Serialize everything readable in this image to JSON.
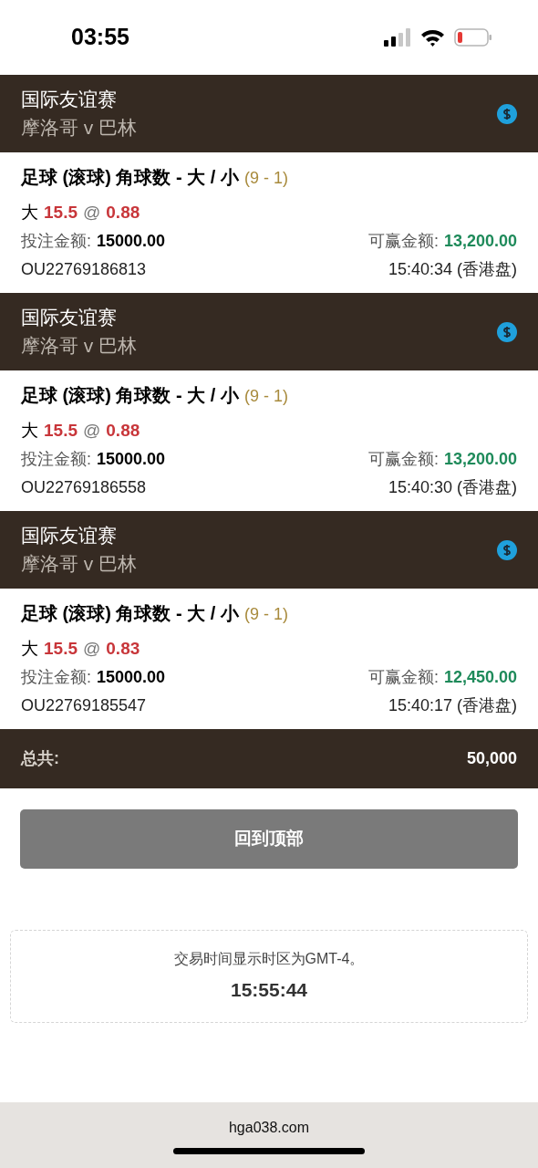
{
  "status_bar": {
    "time": "03:55"
  },
  "bets": [
    {
      "league": "国际友谊赛",
      "match": "摩洛哥 v 巴林",
      "title": "足球 (滚球) 角球数 - 大 / 小",
      "score": "(9 - 1)",
      "side": "大",
      "line": "15.5",
      "at": "@",
      "odds": "0.88",
      "stake_label": "投注金额:",
      "stake": "15000.00",
      "win_label": "可赢金额:",
      "win": "13,200.00",
      "ticket": "OU22769186813",
      "time": "15:40:34 (香港盘)"
    },
    {
      "league": "国际友谊赛",
      "match": "摩洛哥 v 巴林",
      "title": "足球 (滚球) 角球数 - 大 / 小",
      "score": "(9 - 1)",
      "side": "大",
      "line": "15.5",
      "at": "@",
      "odds": "0.88",
      "stake_label": "投注金额:",
      "stake": "15000.00",
      "win_label": "可赢金额:",
      "win": "13,200.00",
      "ticket": "OU22769186558",
      "time": "15:40:30 (香港盘)"
    },
    {
      "league": "国际友谊赛",
      "match": "摩洛哥 v 巴林",
      "title": "足球 (滚球) 角球数 - 大 / 小",
      "score": "(9 - 1)",
      "side": "大",
      "line": "15.5",
      "at": "@",
      "odds": "0.83",
      "stake_label": "投注金额:",
      "stake": "15000.00",
      "win_label": "可赢金额:",
      "win": "12,450.00",
      "ticket": "OU22769185547",
      "time": "15:40:17 (香港盘)"
    }
  ],
  "total": {
    "label": "总共:",
    "value": "50,000"
  },
  "back_to_top": "回到顶部",
  "note": {
    "text": "交易时间显示时区为GMT-4。",
    "time": "15:55:44"
  },
  "browser": {
    "url": "hga038.com"
  }
}
